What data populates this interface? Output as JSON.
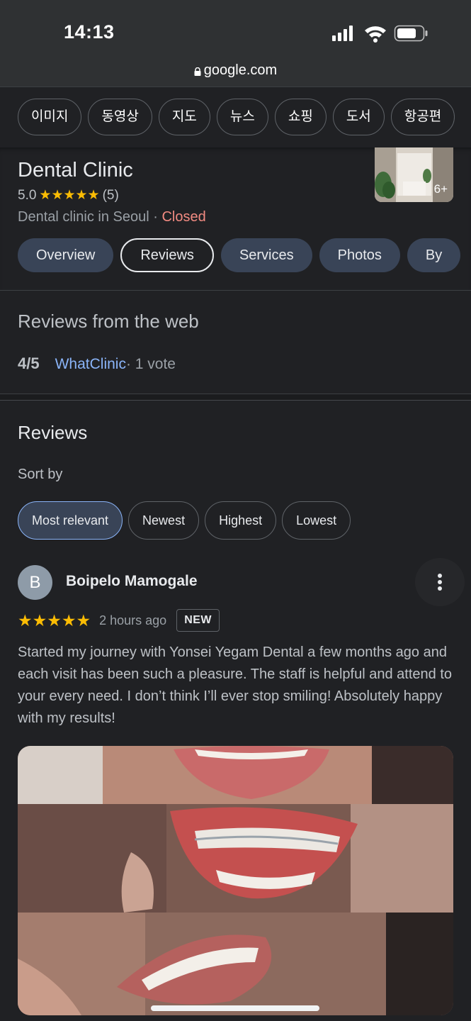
{
  "status_bar": {
    "time": "14:13"
  },
  "browser": {
    "url": "google.com"
  },
  "search_tabs": [
    "이미지",
    "동영상",
    "지도",
    "뉴스",
    "쇼핑",
    "도서",
    "항공편"
  ],
  "business": {
    "name": "Dental Clinic",
    "rating": "5.0",
    "review_count": "(5)",
    "category": "Dental clinic in Seoul",
    "separator": " · ",
    "status": "Closed",
    "photo_more": "6+",
    "status_color": "#f28b82",
    "star_color": "#fbbc04"
  },
  "business_tabs": [
    {
      "label": "Overview",
      "active": false
    },
    {
      "label": "Reviews",
      "active": true
    },
    {
      "label": "Services",
      "active": false
    },
    {
      "label": "Photos",
      "active": false
    },
    {
      "label": "By",
      "active": false
    }
  ],
  "web_reviews": {
    "title": "Reviews from the web",
    "score": "4/5",
    "source": "WhatClinic",
    "votes": " · 1 vote"
  },
  "reviews": {
    "title": "Reviews",
    "sort_label": "Sort by",
    "sort_options": [
      {
        "label": "Most relevant",
        "active": true
      },
      {
        "label": "Newest",
        "active": false
      },
      {
        "label": "Highest",
        "active": false
      },
      {
        "label": "Lowest",
        "active": false
      }
    ],
    "items": [
      {
        "avatar_letter": "B",
        "author": "Boipelo Mamogale",
        "stars": 5,
        "time": "2 hours ago",
        "badge": "NEW",
        "text": "Started my journey with Yonsei Yegam Dental a few months ago and each visit has been such a pleasure. The staff is helpful and attend to your every need. I don’t think I’ll ever stop smiling! Absolutely happy with my results!"
      }
    ]
  },
  "accent_colors": {
    "link": "#8ab4f8",
    "chip_active_bg": "#394457"
  }
}
